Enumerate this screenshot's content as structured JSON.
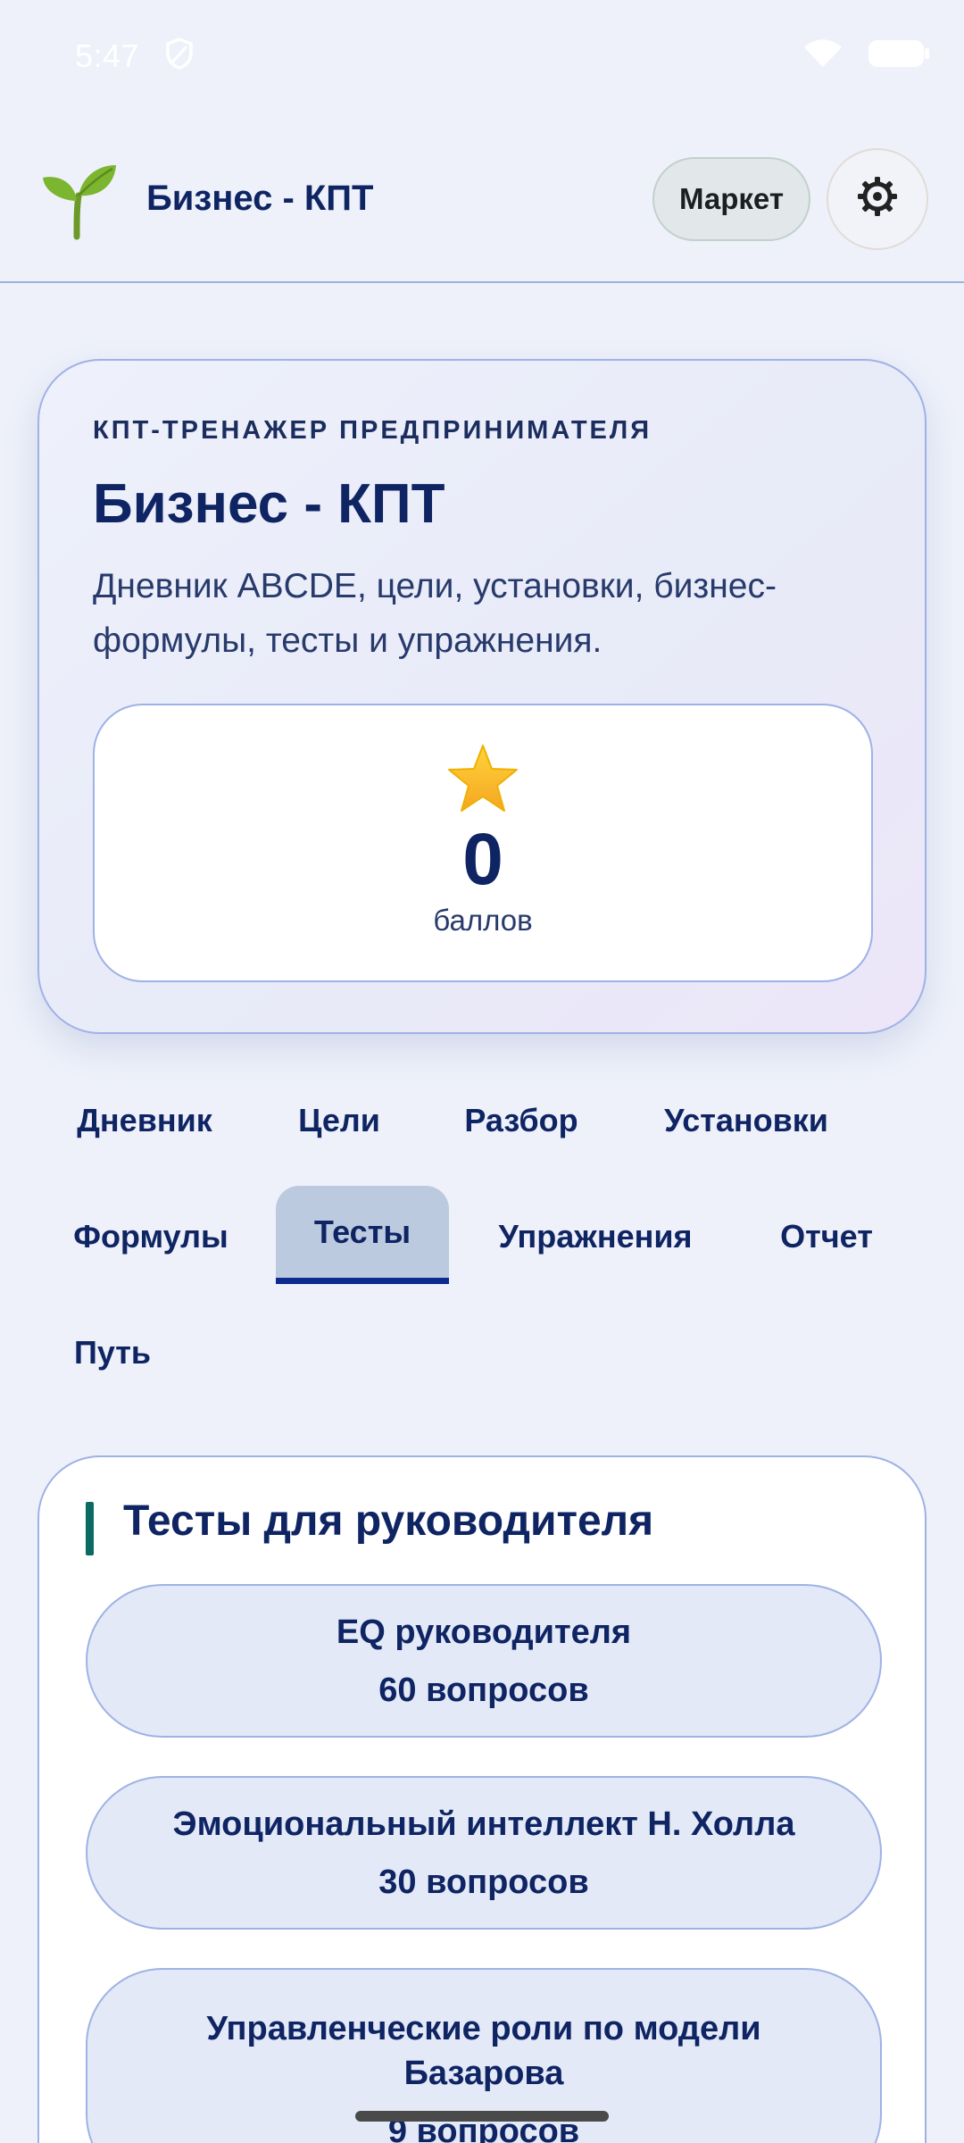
{
  "status_bar": {
    "time": "5:47"
  },
  "app_bar": {
    "title": "Бизнес - КПТ",
    "market_label": "Маркет"
  },
  "hero": {
    "eyebrow": "КПТ-ТРЕНАЖЕР ПРЕДПРИНИМАТЕЛЯ",
    "title": "Бизнес - КПТ",
    "description": "Дневник ABCDE, цели, установки, бизнес-формулы, тесты и упражнения.",
    "points_value": "0",
    "points_label": "баллов"
  },
  "tabs": [
    {
      "label": "Дневник"
    },
    {
      "label": "Цели"
    },
    {
      "label": "Разбор"
    },
    {
      "label": "Установки"
    },
    {
      "label": "Формулы"
    },
    {
      "label": "Тесты"
    },
    {
      "label": "Упражнения"
    },
    {
      "label": "Отчет"
    },
    {
      "label": "Путь"
    }
  ],
  "active_tab": "Тесты",
  "tests_section": {
    "title": "Тесты для руководителя",
    "tests": [
      {
        "name": "EQ руководителя",
        "count": "60 вопросов"
      },
      {
        "name": "Эмоциональный интеллект Н. Холла",
        "count": "30 вопросов"
      },
      {
        "name": "Управленческие роли по модели Базарова",
        "count": "9 вопросов"
      }
    ]
  },
  "colors": {
    "primary": "#0f2463",
    "accent": "#0d2b8f",
    "section_marker": "#0b6b62",
    "background": "#eef1fa"
  }
}
